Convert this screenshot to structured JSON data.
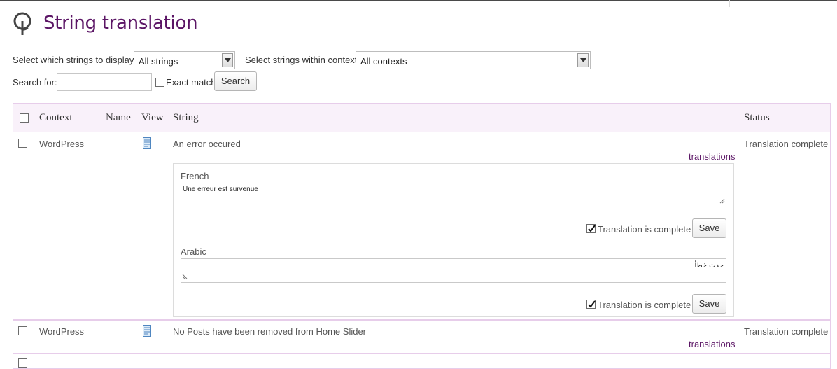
{
  "page": {
    "title": "String translation"
  },
  "filters": {
    "display_label": "Select which strings to display:",
    "display_value": "All strings",
    "context_label": "Select strings within context:",
    "context_value": "All contexts",
    "search_label": "Search for:",
    "search_value": "",
    "exact_match_label": "Exact match",
    "search_button": "Search"
  },
  "table": {
    "headers": {
      "context": "Context",
      "name": "Name",
      "view": "View",
      "string": "String",
      "status": "Status"
    },
    "rows": [
      {
        "context": "WordPress",
        "string": "An error occured",
        "status": "Translation complete",
        "translations_link": "translations",
        "translations": [
          {
            "language": "French",
            "text": "Une erreur est survenue",
            "complete_label": "Translation is complete",
            "save_label": "Save"
          },
          {
            "language": "Arabic",
            "text": "حدث خطأ",
            "complete_label": "Translation is complete",
            "save_label": "Save"
          }
        ]
      },
      {
        "context": "WordPress",
        "string": "No Posts have been removed from Home Slider",
        "status": "Translation complete",
        "translations_link": "translations"
      }
    ]
  },
  "icons": {
    "logo": "wpml-logo-icon",
    "view": "document-icon",
    "dropdown": "chevron-down-icon",
    "check": "checkmark-icon",
    "resize": "resize-grip-icon"
  },
  "colors": {
    "title": "#5b1565",
    "link": "#5b1565",
    "header_bg": "#f9f1fa",
    "border": "#e7cdea"
  }
}
